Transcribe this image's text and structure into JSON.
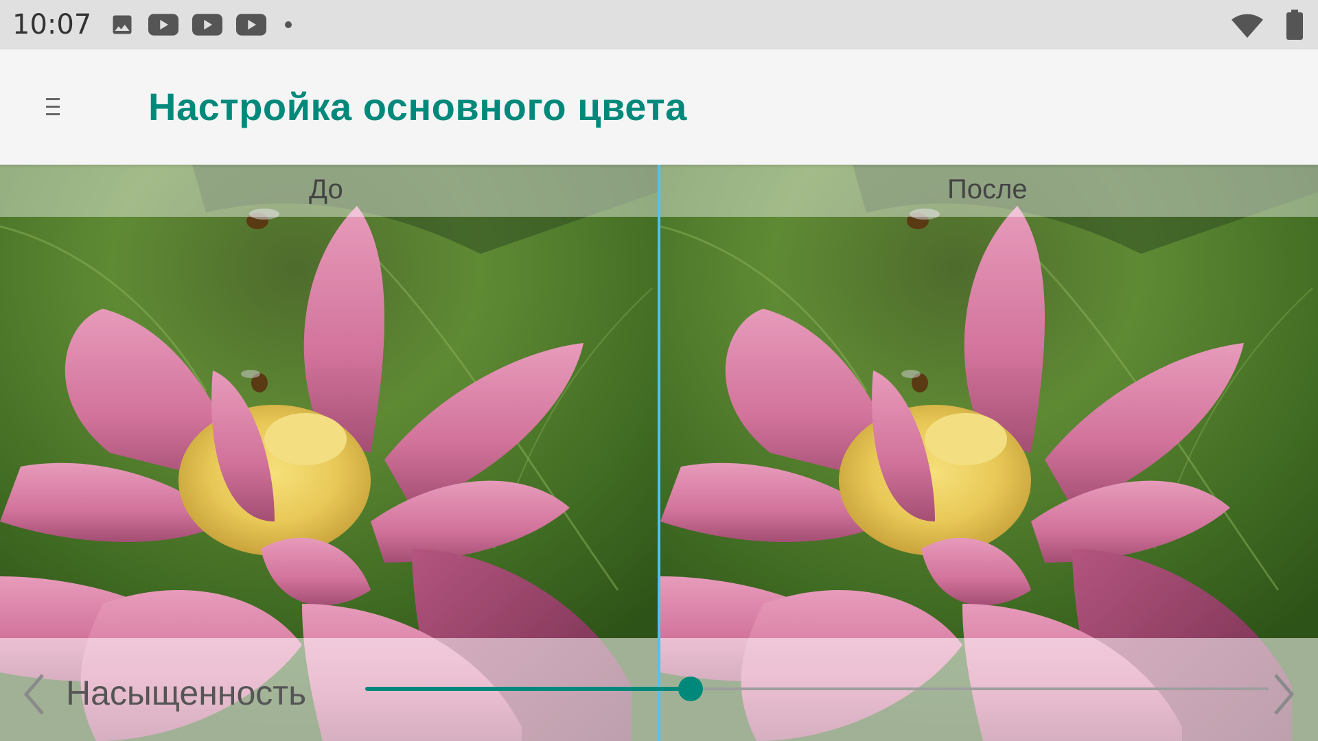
{
  "status_bar": {
    "time": "10:07",
    "notification_icons": [
      "image-icon",
      "youtube-icon",
      "youtube-icon",
      "youtube-icon",
      "dot-icon"
    ],
    "system_icons": [
      "wifi-icon",
      "battery-icon"
    ]
  },
  "app_bar": {
    "title": "Настройка основного цвета",
    "menu_icon": "menu-icon",
    "accent_color": "#00897b"
  },
  "compare": {
    "before_label": "До",
    "after_label": "После",
    "divider_color": "#4fc3f7"
  },
  "control": {
    "setting_label": "Насыщенность",
    "prev_icon": "chevron-left-icon",
    "next_icon": "chevron-right-icon",
    "slider_fraction": 0.36
  }
}
